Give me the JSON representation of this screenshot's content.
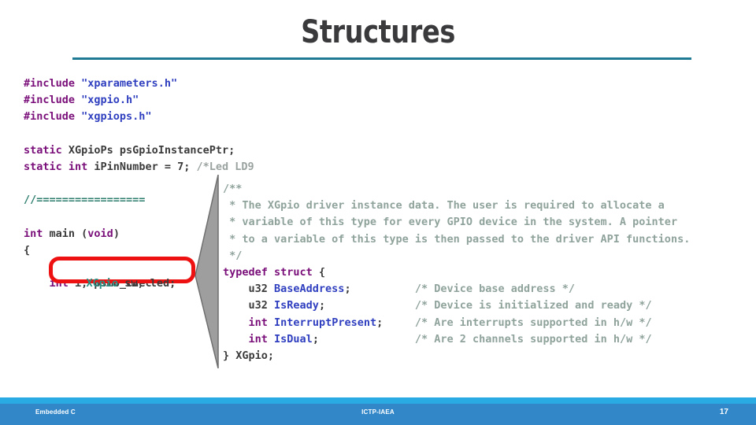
{
  "slide": {
    "title": "Structures",
    "page_number": "17"
  },
  "colors": {
    "title": "#3a3a3c",
    "rule": "#1f7a93",
    "footer_thin": "#2aaae2",
    "footer_main": "#3287c8",
    "highlight_border": "#ee1111",
    "callout_fill": "#9e9e9e"
  },
  "code_left": {
    "lines": [
      {
        "tokens": [
          {
            "t": "#include ",
            "c": "pre"
          },
          {
            "t": "\"xparameters.h\"",
            "c": "str"
          }
        ]
      },
      {
        "tokens": [
          {
            "t": "#include ",
            "c": "pre"
          },
          {
            "t": "\"xgpio.h\"",
            "c": "str"
          }
        ]
      },
      {
        "tokens": [
          {
            "t": "#include ",
            "c": "pre"
          },
          {
            "t": "\"xgpiops.h\"",
            "c": "str"
          }
        ]
      },
      {
        "tokens": []
      },
      {
        "tokens": [
          {
            "t": "static ",
            "c": "kw"
          },
          {
            "t": "XGpioPs psGpioInstancePtr;",
            "c": "plain"
          }
        ]
      },
      {
        "tokens": [
          {
            "t": "static ",
            "c": "kw"
          },
          {
            "t": "int",
            "c": "kw"
          },
          {
            "t": " iPinNumber = ",
            "c": "plain"
          },
          {
            "t": "7",
            "c": "num"
          },
          {
            "t": "; ",
            "c": "plain"
          },
          {
            "t": "/*Led LD9",
            "c": "cmt"
          }
        ]
      },
      {
        "tokens": []
      },
      {
        "tokens": [
          {
            "t": "//=================",
            "c": "sep"
          }
        ]
      },
      {
        "tokens": []
      },
      {
        "tokens": [
          {
            "t": "int",
            "c": "kw"
          },
          {
            "t": " main (",
            "c": "plain"
          },
          {
            "t": "void",
            "c": "kw"
          },
          {
            "t": ")",
            "c": "plain"
          }
        ]
      },
      {
        "tokens": [
          {
            "t": "{",
            "c": "plain"
          }
        ]
      },
      {
        "tokens": []
      },
      {
        "tokens": [
          {
            "t": "    int",
            "c": "kw"
          },
          {
            "t": " i, psmb_chec",
            "c": "plain"
          }
        ]
      }
    ]
  },
  "highlight": {
    "type_token": "XGpio",
    "rest_token": " sw, led;"
  },
  "code_right": {
    "lines": [
      {
        "tokens": [
          {
            "t": "/**",
            "c": "cmt2"
          }
        ]
      },
      {
        "tokens": [
          {
            "t": " * The XGpio driver instance data. The user is required to allocate a",
            "c": "cmt2"
          }
        ]
      },
      {
        "tokens": [
          {
            "t": " * variable of this type for every GPIO device in the system. A pointer",
            "c": "cmt2"
          }
        ]
      },
      {
        "tokens": [
          {
            "t": " * to a variable of this type is then passed to the driver API functions.",
            "c": "cmt2"
          }
        ]
      },
      {
        "tokens": [
          {
            "t": " */",
            "c": "cmt2"
          }
        ]
      },
      {
        "tokens": [
          {
            "t": "typedef struct",
            "c": "kw"
          },
          {
            "t": " {",
            "c": "plain"
          }
        ]
      },
      {
        "tokens": [
          {
            "t": "    u32 ",
            "c": "u32"
          },
          {
            "t": "BaseAddress",
            "c": "field"
          },
          {
            "t": ";",
            "c": "plain"
          },
          {
            "t": "          /* Device base address */",
            "c": "cmt2"
          }
        ]
      },
      {
        "tokens": [
          {
            "t": "    u32 ",
            "c": "u32"
          },
          {
            "t": "IsReady",
            "c": "field"
          },
          {
            "t": ";",
            "c": "plain"
          },
          {
            "t": "              /* Device is initialized and ready */",
            "c": "cmt2"
          }
        ]
      },
      {
        "tokens": [
          {
            "t": "    int",
            "c": "kw"
          },
          {
            "t": " ",
            "c": "plain"
          },
          {
            "t": "InterruptPresent",
            "c": "field"
          },
          {
            "t": ";",
            "c": "plain"
          },
          {
            "t": "     /* Are interrupts supported in h/w */",
            "c": "cmt2"
          }
        ]
      },
      {
        "tokens": [
          {
            "t": "    int",
            "c": "kw"
          },
          {
            "t": " ",
            "c": "plain"
          },
          {
            "t": "IsDual",
            "c": "field"
          },
          {
            "t": ";",
            "c": "plain"
          },
          {
            "t": "               /* Are 2 channels supported in h/w */",
            "c": "cmt2"
          }
        ]
      },
      {
        "tokens": [
          {
            "t": "} XGpio;",
            "c": "plain"
          }
        ]
      }
    ]
  },
  "footer": {
    "left": "Embedded C",
    "center": "ICTP-IAEA"
  }
}
